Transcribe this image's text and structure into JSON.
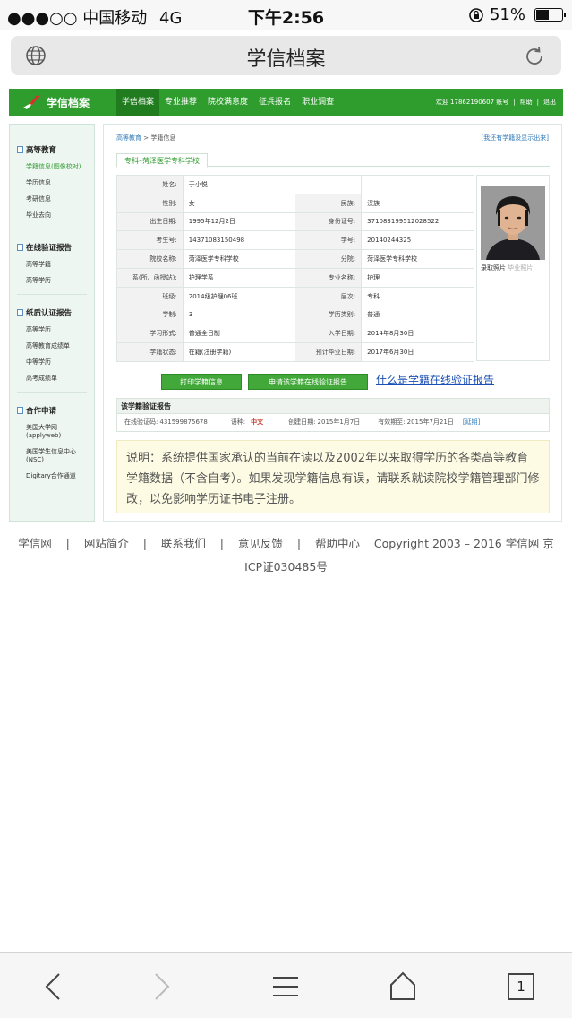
{
  "status_bar": {
    "signal": "●●●○○",
    "carrier": "中国移动",
    "network": "4G",
    "time": "下午2:56",
    "battery_percent": "51%",
    "battery_level": 0.51
  },
  "browser": {
    "title": "学信档案"
  },
  "header": {
    "brand": "学信档案",
    "nav": [
      "学信档案",
      "专业推荐",
      "院校满意度",
      "征兵报名",
      "职业调查"
    ],
    "welcome": "欢迎 17862190607 账号",
    "help": "帮助",
    "logout": "退出"
  },
  "sidebar": {
    "groups": [
      {
        "title": "高等教育",
        "items": [
          "学籍信息(图像校对)",
          "学历信息",
          "考研信息",
          "毕业去向"
        ]
      },
      {
        "title": "在线验证报告",
        "items": [
          "高等学籍",
          "高等学历"
        ]
      },
      {
        "title": "纸质认证报告",
        "items": [
          "高等学历",
          "高等教育成绩单",
          "中等学历",
          "高考成绩单"
        ]
      },
      {
        "title": "合作申请",
        "items": [
          "美国大学网",
          "(applyweb)",
          "美国学生信息中心",
          "(NSC)",
          "Digitary合作通道"
        ]
      }
    ]
  },
  "main": {
    "breadcrumb_link": "高等教育",
    "breadcrumb_sep": ">",
    "breadcrumb_current": "学籍信息",
    "missing_link": "[我还有学籍没显示出来]",
    "school_tab": "专科–菏泽医学专科学校",
    "info": {
      "name_label": "姓名:",
      "name": "于小悦",
      "gender_label": "性别:",
      "gender": "女",
      "ethnicity_label": "民族:",
      "ethnicity": "汉族",
      "birth_label": "出生日期:",
      "birth": "1995年12月2日",
      "id_label": "身份证号:",
      "id": "371083199512028522",
      "exam_label": "考生号:",
      "exam": "14371083150498",
      "student_label": "学号:",
      "student": "20140244325",
      "school_label": "院校名称:",
      "school": "菏泽医学专科学校",
      "branch_label": "分院:",
      "branch": "菏泽医学专科学校",
      "dept_label": "系(所、函授站):",
      "dept": "护理学系",
      "major_label": "专业名称:",
      "major": "护理",
      "class_label": "班级:",
      "class": "2014级护理06班",
      "level_label": "层次:",
      "level": "专科",
      "duration_label": "学制:",
      "duration": "3",
      "type_label": "学历类别:",
      "type": "普通",
      "form_label": "学习形式:",
      "form": "普通全日制",
      "enroll_label": "入学日期:",
      "enroll": "2014年8月30日",
      "status_label": "学籍状态:",
      "status": "在籍(注册学籍)",
      "grad_label": "预计毕业日期:",
      "grad": "2017年6月30日"
    },
    "photo_caption": "录取照片",
    "photo_caption_alt": "毕业照片",
    "print_button": "打印学籍信息",
    "apply_button": "申请该学籍在线验证报告",
    "what_link": "什么是学籍在线验证报告",
    "verify": {
      "title": "该学籍验证报告",
      "code_label": "在线验证码:",
      "code": "431599875678",
      "lang_label": "语种:",
      "lang": "中文",
      "created_label": "创建日期:",
      "created": "2015年1月7日",
      "valid_label": "有效期至:",
      "valid": "2015年7月21日",
      "extend": "[延期]"
    },
    "note": "说明：系统提供国家承认的当前在读以及2002年以来取得学历的各类高等教育学籍数据（不含自考）。如果发现学籍信息有误，请联系就读院校学籍管理部门修改，以免影响学历证书电子注册。"
  },
  "footer": {
    "links": [
      "学信网",
      "网站简介",
      "联系我们",
      "意见反馈",
      "帮助中心"
    ],
    "copyright": "Copyright 2003 – 2016 学信网 京",
    "icp": "ICP证030485号"
  },
  "toolbar": {
    "tabs_count": "1"
  }
}
